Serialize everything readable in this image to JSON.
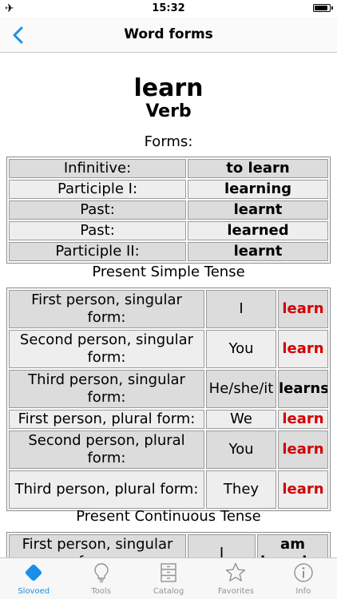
{
  "status_bar": {
    "time": "15:32",
    "battery_level": 0.9
  },
  "nav": {
    "title": "Word forms"
  },
  "header": {
    "word": "learn",
    "part_of_speech": "Verb"
  },
  "forms": {
    "caption": "Forms:",
    "rows": [
      {
        "label": "Infinitive:",
        "value": "to learn"
      },
      {
        "label": "Participle I:",
        "value": "learning"
      },
      {
        "label": "Past:",
        "value": "learnt"
      },
      {
        "label": "Past:",
        "value": "learned"
      },
      {
        "label": "Participle II:",
        "value": "learnt"
      }
    ]
  },
  "present_simple": {
    "caption": "Present Simple Tense",
    "rows": [
      {
        "person": "First person, singular form:",
        "pronoun": "I",
        "verb": "learn",
        "verb_color": "red"
      },
      {
        "person": "Second person, singular form:",
        "pronoun": "You",
        "verb": "learn",
        "verb_color": "red"
      },
      {
        "person": "Third person, singular form:",
        "pronoun": "He/she/it",
        "verb": "learns",
        "verb_color": "black"
      },
      {
        "person": "First person, plural form:",
        "pronoun": "We",
        "verb": "learn",
        "verb_color": "red"
      },
      {
        "person": "Second person, plural form:",
        "pronoun": "You",
        "verb": "learn",
        "verb_color": "red"
      },
      {
        "person": "Third person, plural form:",
        "pronoun": "They",
        "verb": "learn",
        "verb_color": "red"
      }
    ]
  },
  "present_continuous": {
    "caption": "Present Continuous Tense",
    "rows": [
      {
        "person": "First person, singular form:",
        "pronoun": "I",
        "verb": "am learning"
      }
    ]
  },
  "tab_bar": {
    "tabs": [
      {
        "label": "Slovoed",
        "icon": "slovoed-icon",
        "active": true
      },
      {
        "label": "Tools",
        "icon": "lightbulb-icon",
        "active": false
      },
      {
        "label": "Catalog",
        "icon": "catalog-icon",
        "active": false
      },
      {
        "label": "Favorites",
        "icon": "star-icon",
        "active": false
      },
      {
        "label": "Info",
        "icon": "info-icon",
        "active": false
      }
    ]
  },
  "colors": {
    "accent": "#1a8fe8",
    "highlight_red": "#d40000",
    "row_dark": "#dcdcdc",
    "row_light": "#eeeeee"
  }
}
